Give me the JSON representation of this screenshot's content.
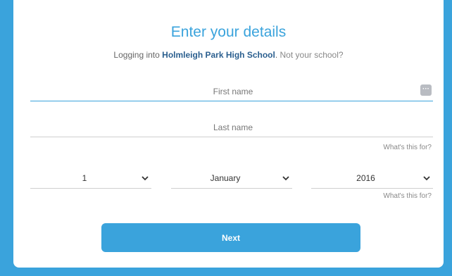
{
  "heading": "Enter your details",
  "subtitle": {
    "prefix": "Logging into ",
    "school": "Holmleigh Park High School",
    "suffix": ". ",
    "not_school_link": "Not your school?"
  },
  "fields": {
    "first_name": {
      "placeholder": "First name",
      "value": ""
    },
    "last_name": {
      "placeholder": "Last name",
      "value": ""
    }
  },
  "help_link_1": "What's this for?",
  "dob": {
    "day": "1",
    "month": "January",
    "year": "2016"
  },
  "help_link_2": "What's this for?",
  "next_button": "Next",
  "colors": {
    "accent": "#3aa3dc",
    "school_text": "#2b5f8f"
  },
  "icons": {
    "keyboard": "keyboard-icon",
    "chevron": "chevron-down-icon"
  }
}
